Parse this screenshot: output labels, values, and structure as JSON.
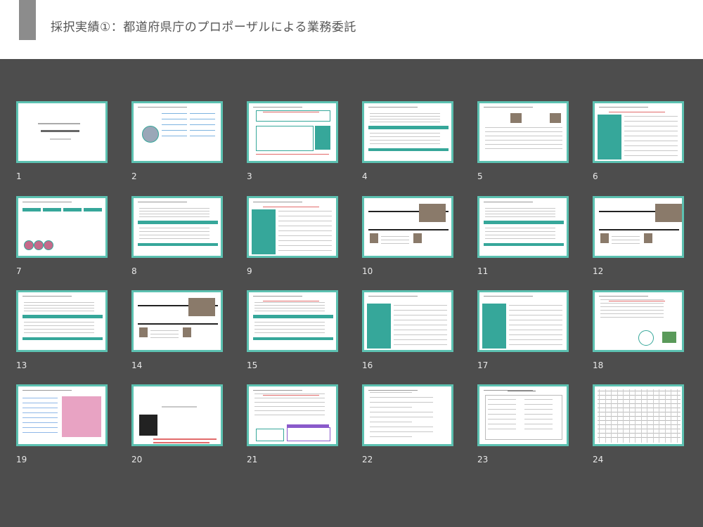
{
  "header": {
    "title": "採択実績①：都道府県庁のプロポーザルによる業務委託"
  },
  "slides": [
    {
      "number": "1"
    },
    {
      "number": "2"
    },
    {
      "number": "3"
    },
    {
      "number": "4"
    },
    {
      "number": "5"
    },
    {
      "number": "6"
    },
    {
      "number": "7"
    },
    {
      "number": "8"
    },
    {
      "number": "9"
    },
    {
      "number": "10"
    },
    {
      "number": "11"
    },
    {
      "number": "12"
    },
    {
      "number": "13"
    },
    {
      "number": "14"
    },
    {
      "number": "15"
    },
    {
      "number": "16"
    },
    {
      "number": "17"
    },
    {
      "number": "18"
    },
    {
      "number": "19"
    },
    {
      "number": "20"
    },
    {
      "number": "21"
    },
    {
      "number": "22"
    },
    {
      "number": "23"
    },
    {
      "number": "24"
    }
  ],
  "colors": {
    "accent": "#5cc1b1",
    "background": "#4d4d4d",
    "header_bg": "#ffffff",
    "header_accent": "#8c8c8c"
  }
}
